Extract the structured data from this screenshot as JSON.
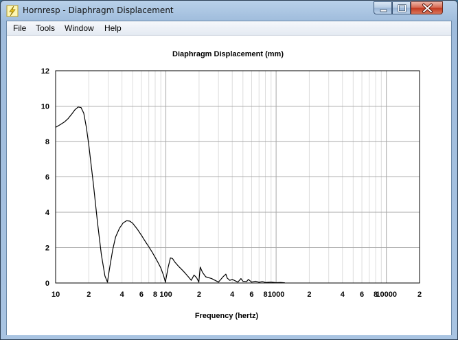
{
  "window": {
    "title": "Hornresp - Diaphragm Displacement",
    "controls": {
      "minimize": "minimize",
      "maximize": "maximize",
      "close": "close"
    }
  },
  "menu": [
    {
      "label": "File"
    },
    {
      "label": "Tools"
    },
    {
      "label": "Window"
    },
    {
      "label": "Help"
    }
  ],
  "chart_data": {
    "type": "line",
    "title": "Diaphragm Displacement (mm)",
    "xlabel": "Frequency (hertz)",
    "ylabel": "",
    "xscale": "log",
    "xlim": [
      10,
      20000
    ],
    "ylim": [
      0,
      12
    ],
    "grid": true,
    "yticks": [
      "0",
      "2",
      "4",
      "6",
      "8",
      "10",
      "12"
    ],
    "xticks": [
      {
        "value": 10,
        "label": "10"
      },
      {
        "value": 20,
        "label": "2"
      },
      {
        "value": 40,
        "label": "4"
      },
      {
        "value": 60,
        "label": "6"
      },
      {
        "value": 80,
        "label": "8"
      },
      {
        "value": 100,
        "label": "100"
      },
      {
        "value": 200,
        "label": "2"
      },
      {
        "value": 400,
        "label": "4"
      },
      {
        "value": 600,
        "label": "6"
      },
      {
        "value": 800,
        "label": "8"
      },
      {
        "value": 1000,
        "label": "1000"
      },
      {
        "value": 2000,
        "label": "2"
      },
      {
        "value": 4000,
        "label": "4"
      },
      {
        "value": 6000,
        "label": "6"
      },
      {
        "value": 8000,
        "label": "8"
      },
      {
        "value": 10000,
        "label": "10000"
      },
      {
        "value": 20000,
        "label": "2"
      }
    ],
    "series": [
      {
        "color": "#000000",
        "x": [
          10,
          11,
          12,
          13,
          14,
          15,
          16,
          17,
          18,
          19,
          20,
          22,
          24,
          26,
          28,
          29.5,
          31,
          33,
          35,
          38,
          41,
          44,
          47,
          50,
          55,
          60,
          65,
          70,
          75,
          80,
          85,
          90,
          95,
          99,
          105,
          110,
          115,
          120,
          130,
          140,
          150,
          160,
          170,
          180,
          190,
          199,
          205,
          215,
          230,
          260,
          300,
          330,
          350,
          360,
          380,
          400,
          450,
          480,
          500,
          540,
          560,
          600,
          650,
          700,
          750,
          800,
          900,
          1000,
          1100,
          1200
        ],
        "y": [
          8.8,
          8.95,
          9.1,
          9.3,
          9.55,
          9.8,
          9.95,
          9.92,
          9.6,
          8.8,
          7.8,
          5.6,
          3.4,
          1.6,
          0.4,
          0.05,
          0.9,
          1.9,
          2.6,
          3.1,
          3.4,
          3.52,
          3.5,
          3.38,
          3.05,
          2.7,
          2.35,
          2.05,
          1.75,
          1.45,
          1.15,
          0.85,
          0.45,
          0.05,
          0.9,
          1.42,
          1.38,
          1.2,
          0.95,
          0.75,
          0.55,
          0.35,
          0.15,
          0.45,
          0.3,
          0.05,
          0.9,
          0.6,
          0.35,
          0.25,
          0.05,
          0.35,
          0.5,
          0.28,
          0.15,
          0.2,
          0.05,
          0.25,
          0.1,
          0.08,
          0.2,
          0.05,
          0.1,
          0.04,
          0.08,
          0.03,
          0.05,
          0.02,
          0.03,
          0.01
        ]
      }
    ]
  }
}
